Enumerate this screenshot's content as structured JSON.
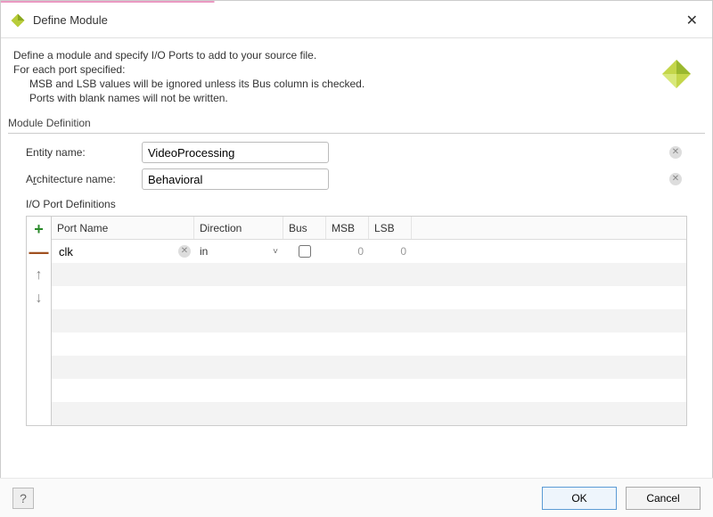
{
  "window": {
    "title": "Define Module"
  },
  "description": {
    "line1": "Define a module and specify I/O Ports to add to your source file.",
    "line2": "For each port specified:",
    "line3": "MSB and LSB values will be ignored unless its Bus column is checked.",
    "line4": "Ports with blank names will not be written."
  },
  "section": {
    "module_definition": "Module Definition",
    "io_ports": "I/O Port Definitions"
  },
  "labels": {
    "entity_name_prefix": "E",
    "entity_name_rest": "ntity name:",
    "arch_name_prefix": "A",
    "arch_name_underline": "r",
    "arch_name_rest": "chitecture name:"
  },
  "fields": {
    "entity_name": "VideoProcessing",
    "architecture_name": "Behavioral"
  },
  "table": {
    "headers": {
      "port_name": "Port Name",
      "direction": "Direction",
      "bus": "Bus",
      "msb": "MSB",
      "lsb": "LSB"
    },
    "rows": [
      {
        "name": "clk",
        "direction": "in",
        "bus": false,
        "msb": "0",
        "lsb": "0"
      }
    ]
  },
  "buttons": {
    "ok": "OK",
    "cancel": "Cancel",
    "help": "?"
  },
  "icons": {
    "close": "✕",
    "add": "+",
    "remove": "—",
    "up": "↑",
    "down": "↓",
    "chevron": "˅",
    "clear": "✕"
  }
}
